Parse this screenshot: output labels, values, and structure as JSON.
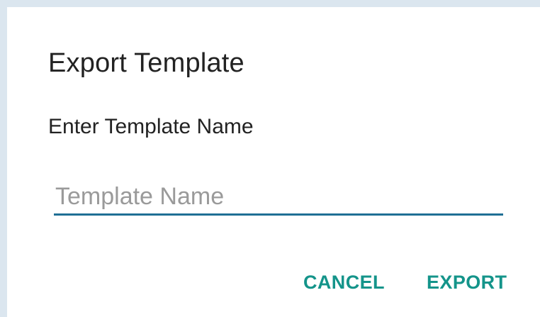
{
  "dialog": {
    "title": "Export Template",
    "message": "Enter Template Name",
    "input": {
      "value": "",
      "placeholder": "Template Name"
    },
    "buttons": {
      "cancel_label": "CANCEL",
      "export_label": "EXPORT"
    }
  },
  "colors": {
    "accent": "#14948a",
    "input_underline": "#1f6f95",
    "text": "#222222",
    "placeholder": "#9a9a9a",
    "frame": "#dbe6ef"
  }
}
